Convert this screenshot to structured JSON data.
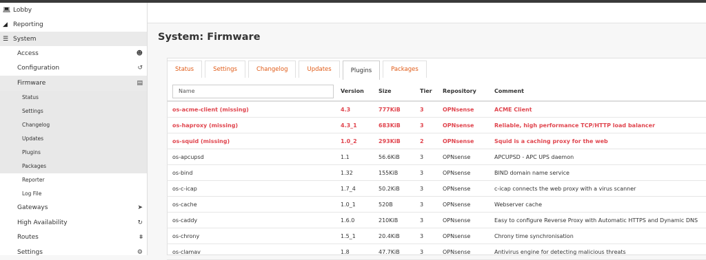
{
  "sidebar": {
    "top_items": [
      {
        "label": "Lobby",
        "icon": "laptop-icon"
      },
      {
        "label": "Reporting",
        "icon": "area-chart-icon"
      },
      {
        "label": "System",
        "icon": "server-icon"
      }
    ],
    "sub_items": [
      {
        "label": "Access",
        "icon": "users-icon"
      },
      {
        "label": "Configuration",
        "icon": "history-icon"
      },
      {
        "label": "Firmware",
        "icon": "building-icon"
      }
    ],
    "firmware_items": [
      "Status",
      "Settings",
      "Changelog",
      "Updates",
      "Plugins",
      "Packages"
    ],
    "extra_items": [
      "Reporter",
      "Log File"
    ],
    "bottom_items": [
      {
        "label": "Gateways",
        "icon": "location-arrow-icon"
      },
      {
        "label": "High Availability",
        "icon": "refresh-icon"
      },
      {
        "label": "Routes",
        "icon": "map-signs-icon"
      },
      {
        "label": "Settings",
        "icon": "cogs-icon"
      }
    ]
  },
  "page": {
    "title": "System: Firmware"
  },
  "tabs": [
    "Status",
    "Settings",
    "Changelog",
    "Updates",
    "Plugins",
    "Packages"
  ],
  "active_tab": "Plugins",
  "table": {
    "name_placeholder": "Name",
    "headers": [
      "Version",
      "Size",
      "Tier",
      "Repository",
      "Comment"
    ],
    "rows": [
      {
        "name": "os-acme-client (missing)",
        "version": "4.3",
        "size": "777KiB",
        "tier": "3",
        "repo": "OPNsense",
        "comment": "ACME Client",
        "missing": true
      },
      {
        "name": "os-haproxy (missing)",
        "version": "4.3_1",
        "size": "683KiB",
        "tier": "3",
        "repo": "OPNsense",
        "comment": "Reliable, high performance TCP/HTTP load balancer",
        "missing": true
      },
      {
        "name": "os-squid (missing)",
        "version": "1.0_2",
        "size": "293KiB",
        "tier": "2",
        "repo": "OPNsense",
        "comment": "Squid is a caching proxy for the web",
        "missing": true
      },
      {
        "name": "os-apcupsd",
        "version": "1.1",
        "size": "56.6KiB",
        "tier": "3",
        "repo": "OPNsense",
        "comment": "APCUPSD - APC UPS daemon",
        "missing": false
      },
      {
        "name": "os-bind",
        "version": "1.32",
        "size": "155KiB",
        "tier": "3",
        "repo": "OPNsense",
        "comment": "BIND domain name service",
        "missing": false
      },
      {
        "name": "os-c-icap",
        "version": "1.7_4",
        "size": "50.2KiB",
        "tier": "3",
        "repo": "OPNsense",
        "comment": "c-icap connects the web proxy with a virus scanner",
        "missing": false
      },
      {
        "name": "os-cache",
        "version": "1.0_1",
        "size": "520B",
        "tier": "3",
        "repo": "OPNsense",
        "comment": "Webserver cache",
        "missing": false
      },
      {
        "name": "os-caddy",
        "version": "1.6.0",
        "size": "210KiB",
        "tier": "3",
        "repo": "OPNsense",
        "comment": "Easy to configure Reverse Proxy with Automatic HTTPS and Dynamic DNS",
        "missing": false
      },
      {
        "name": "os-chrony",
        "version": "1.5_1",
        "size": "20.4KiB",
        "tier": "3",
        "repo": "OPNsense",
        "comment": "Chrony time synchronisation",
        "missing": false
      },
      {
        "name": "os-clamav",
        "version": "1.8",
        "size": "47.7KiB",
        "tier": "3",
        "repo": "OPNsense",
        "comment": "Antivirus engine for detecting malicious threats",
        "missing": false
      }
    ]
  },
  "colors": {
    "accent": "#e05a16",
    "missing": "#e0454e"
  }
}
